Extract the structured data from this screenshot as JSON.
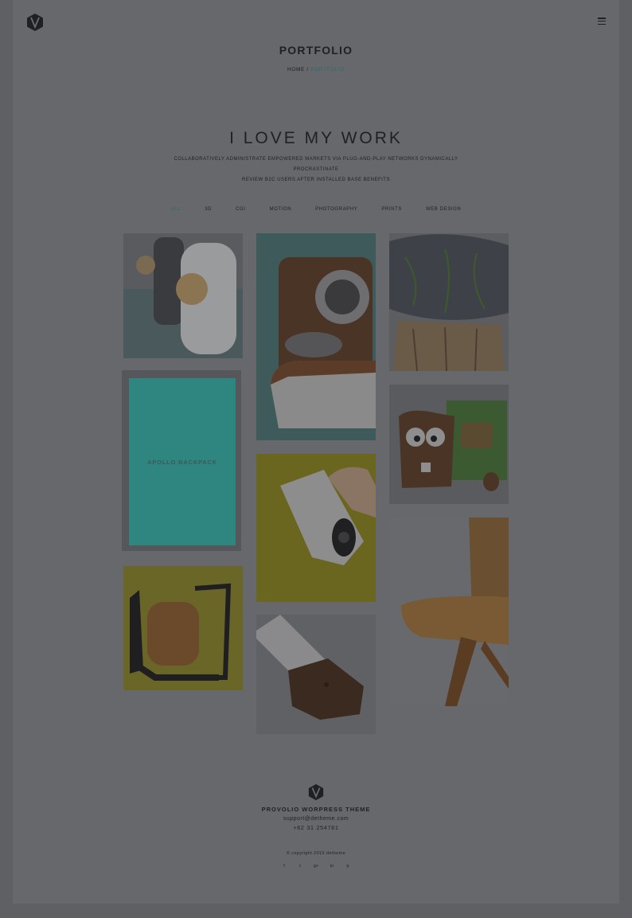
{
  "header": {
    "logo_icon": "v-logo-icon",
    "menu_icon": "hamburger-menu-icon",
    "page_title": "PORTFOLIO",
    "breadcrumb": {
      "home": "HOME",
      "separator": "/",
      "current": "PORTFOLIO"
    }
  },
  "intro": {
    "title": "I LOVE MY WORK",
    "tagline_line1": "COLLABORATIVELY ADMINISTRATE EMPOWERED MARKETS VIA PLUG-AND-PLAY NETWORKS DYNAMICALLY PROCRASTINATE",
    "tagline_line2": "REVIEW B2C USERS AFTER INSTALLED BASE BENEFITS"
  },
  "filters": [
    "ALL",
    "3D",
    "CGI",
    "MOTION",
    "PHOTOGRAPHY",
    "PRINTS",
    "WEB DESIGN"
  ],
  "active_filter": "ALL",
  "portfolio": {
    "hover_caption": "APOLLO BACKPACK"
  },
  "footer": {
    "brand": "PROVOLIO WORPRESS THEME",
    "email": "support@detheme.com",
    "phone": "+62 31 254781",
    "copyright": "© copyright 2015 detheme",
    "social": [
      {
        "icon": "facebook-icon",
        "glyph": "f"
      },
      {
        "icon": "twitter-icon",
        "glyph": "t"
      },
      {
        "icon": "google-plus-icon",
        "glyph": "g+"
      },
      {
        "icon": "linkedin-icon",
        "glyph": "in"
      },
      {
        "icon": "pinterest-icon",
        "glyph": "p"
      }
    ]
  },
  "colors": {
    "overlay_bg": "#67686c",
    "accent": "#2e6a68",
    "hover_teal": "#2f8580",
    "text": "#1f2023"
  }
}
